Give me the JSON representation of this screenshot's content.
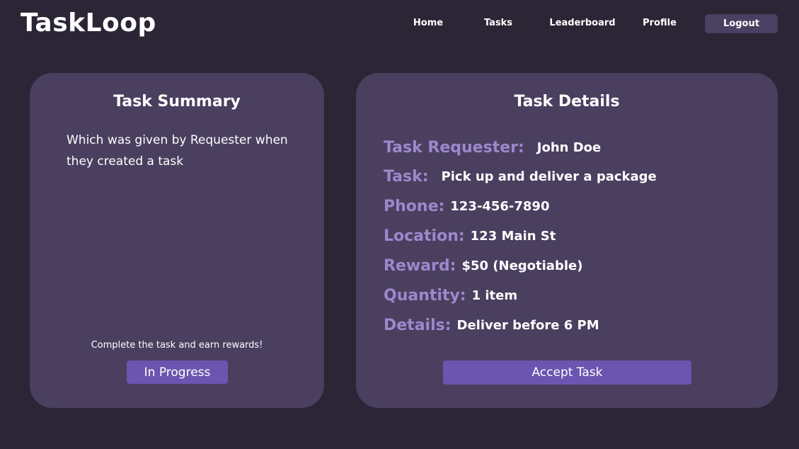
{
  "header": {
    "logo": "TaskLoop",
    "nav": {
      "home": "Home",
      "tasks": "Tasks",
      "leaderboard": "Leaderboard",
      "profile": "Profile"
    },
    "logout_label": "Logout"
  },
  "summary": {
    "title": "Task Summary",
    "text": "Which was given by Requester when they created a task",
    "footer": "Complete the task and earn rewards!",
    "status_label": "In Progress"
  },
  "details": {
    "title": "Task Details",
    "rows": [
      {
        "label": "Task Requester:",
        "value": "John Doe"
      },
      {
        "label": "Task:",
        "value": "Pick up and deliver a package"
      },
      {
        "label": "Phone:",
        "value": "123-456-7890"
      },
      {
        "label": "Location:",
        "value": "123 Main St"
      },
      {
        "label": "Reward:",
        "value": "$50 (Negotiable)"
      },
      {
        "label": "Quantity:",
        "value": "1 item"
      },
      {
        "label": "Details:",
        "value": "Deliver before 6 PM"
      }
    ],
    "accept_label": "Accept Task"
  },
  "colors": {
    "background": "#2b2535",
    "card": "#4a3f5f",
    "accent": "#6b55b0",
    "label": "#9c88cc",
    "logout": "#4b4061"
  }
}
